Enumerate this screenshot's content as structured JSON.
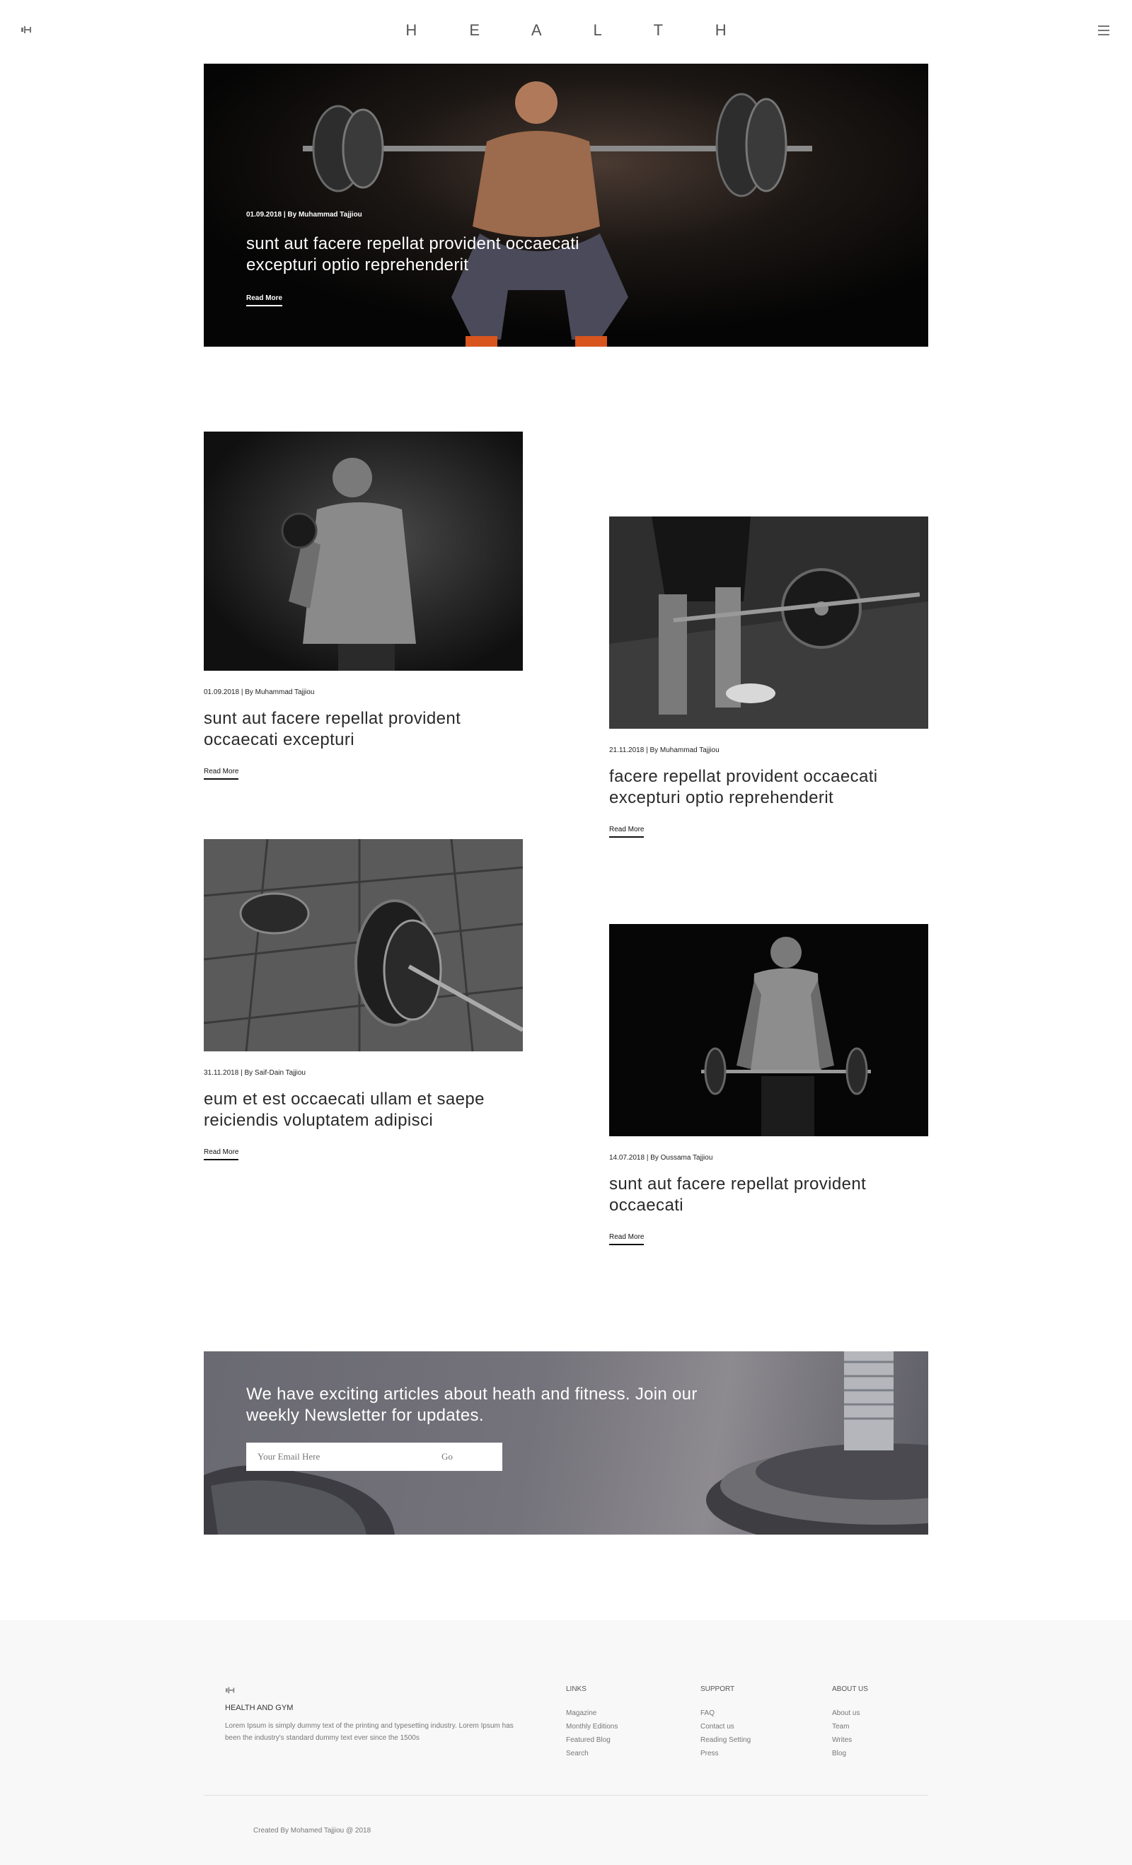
{
  "header": {
    "title": "H E A L T H",
    "logo_icon": "dumbbell-icon",
    "menu_icon": "hamburger-menu-icon"
  },
  "hero": {
    "meta": "01.09.2018 | By Muhammad Tajjiou",
    "title": "sunt aut facere repellat provident occaecati excepturi optio reprehenderit",
    "read_more": "Read More"
  },
  "posts": [
    {
      "meta": "01.09.2018 | By Muhammad Tajjiou",
      "title": "sunt aut facere repellat provident occaecati excepturi",
      "read_more": "Read More"
    },
    {
      "meta": "21.11.2018 | By Muhammad Tajjiou",
      "title": "facere repellat provident occaecati excepturi optio reprehenderit",
      "read_more": "Read More"
    },
    {
      "meta": "31.11.2018 | By Saif-Dain Tajjiou",
      "title": "eum et est occaecati ullam et saepe reiciendis voluptatem adipisci",
      "read_more": "Read More"
    },
    {
      "meta": "14.07.2018 | By Oussama Tajjiou",
      "title": "sunt aut facere repellat provident occaecati",
      "read_more": "Read More"
    }
  ],
  "newsletter": {
    "text": "We have exciting articles about heath and fitness. Join our weekly Newsletter for updates.",
    "placeholder": "Your Email Here",
    "button": "Go"
  },
  "footer": {
    "brand": "HEALTH AND GYM",
    "description": "Lorem Ipsum is simply dummy text of the printing and typesetting industry. Lorem Ipsum has been the industry's standard dummy text ever since the 1500s",
    "columns": [
      {
        "heading": "LINKS",
        "links": [
          "Magazine",
          "Monthly Editions",
          "Featured Blog",
          "Search"
        ]
      },
      {
        "heading": "SUPPORT",
        "links": [
          "FAQ",
          "Contact us",
          "Reading Setting",
          "Press"
        ]
      },
      {
        "heading": "ABOUT US",
        "links": [
          "About us",
          "Team",
          "Writes",
          "Blog"
        ]
      }
    ],
    "copyright": "Created By Mohamed Tajjiou @ 2018"
  }
}
